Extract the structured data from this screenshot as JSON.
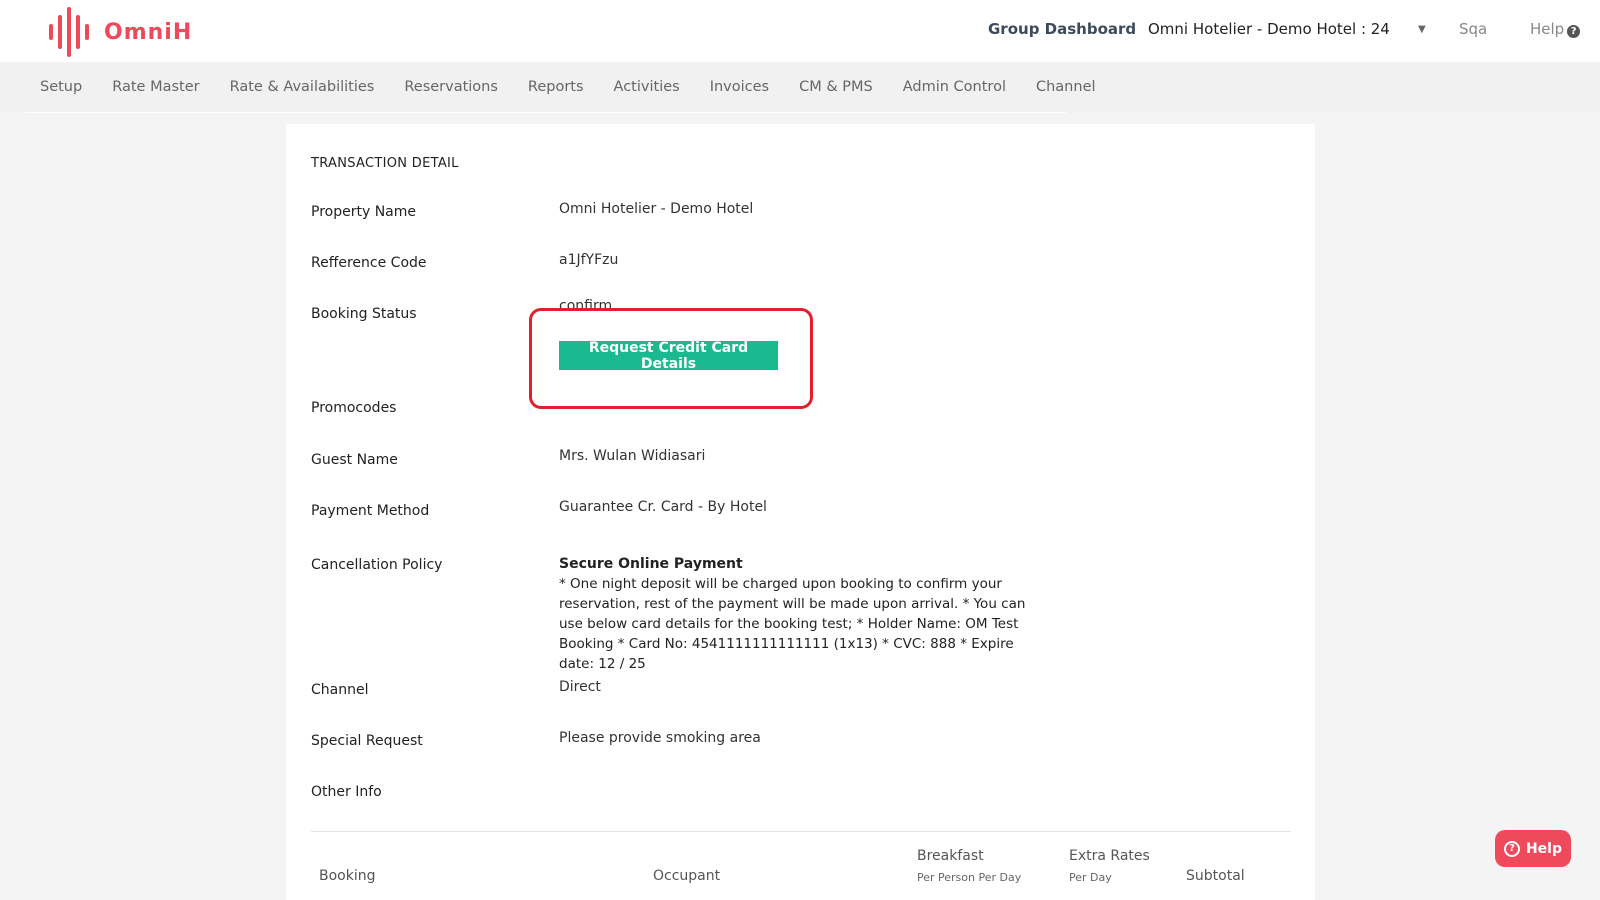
{
  "app": {
    "brand": "OmniH",
    "brand_color": "#ee4a5b"
  },
  "header": {
    "group_dashboard": "Group Dashboard",
    "hotel_selector": "Omni Hotelier - Demo Hotel : 24",
    "user": "Sqa",
    "help": "Help"
  },
  "nav": {
    "items": [
      "Setup",
      "Rate Master",
      "Rate & Availabilities",
      "Reservations",
      "Reports",
      "Activities",
      "Invoices",
      "CM & PMS",
      "Admin Control",
      "Channel"
    ]
  },
  "transaction": {
    "section_title": "TRANSACTION DETAIL",
    "property_name_label": "Property Name",
    "property_name": "Omni Hotelier - Demo Hotel",
    "reference_code_label": "Refference Code",
    "reference_code": "a1JfYFzu",
    "booking_status_label": "Booking Status",
    "booking_status": "confirm",
    "request_cc_button": "Request Credit Card Details",
    "promocodes_label": "Promocodes",
    "guest_name_label": "Guest Name",
    "guest_name": "Mrs. Wulan Widiasari",
    "payment_method_label": "Payment Method",
    "payment_method": "Guarantee Cr. Card - By Hotel",
    "cancellation_policy_label": "Cancellation Policy",
    "cancellation_policy_title": "Secure Online Payment",
    "cancellation_policy_text": "* One night deposit will be charged upon booking to confirm your reservation, rest of the payment will be made upon arrival. * You can use below card details for the booking test; * Holder Name: OM Test Booking * Card No: 4541111111111111 (1x13) * CVC: 888 * Expire date: 12 / 25",
    "channel_label": "Channel",
    "channel": "Direct",
    "special_request_label": "Special Request",
    "special_request": "Please provide smoking area",
    "other_info_label": "Other Info"
  },
  "table": {
    "col_booking": "Booking",
    "col_occupant": "Occupant",
    "col_breakfast": "Breakfast",
    "col_breakfast_sub": "Per Person Per Day",
    "col_extra_rates": "Extra Rates",
    "col_extra_rates_sub": "Per Day",
    "col_subtotal": "Subtotal"
  },
  "floating_help": {
    "label": "Help"
  },
  "colors": {
    "accent_green": "#1bb98f",
    "highlight_red": "#e51e2c"
  }
}
